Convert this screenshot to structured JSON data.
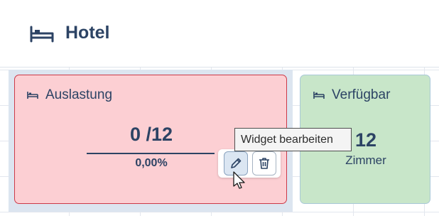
{
  "header": {
    "title": "Hotel",
    "icon": "bed-icon"
  },
  "widgets": [
    {
      "title": "Auslastung",
      "icon": "bed-icon",
      "value_text": "0 /12",
      "percent_text": "0,00%",
      "background": "#fccfd3",
      "border": "#cc3a48",
      "occupied": 0,
      "total": 12
    },
    {
      "title": "Verfügbar",
      "icon": "bed-icon",
      "value_text": "12",
      "unit_label": "Zimmer",
      "background": "#c8e6c9"
    }
  ],
  "toolbar": {
    "edit_icon": "pencil-icon",
    "delete_icon": "trash-icon"
  },
  "tooltip": {
    "text": "Widget bearbeiten"
  },
  "colors": {
    "text": "#2c4364",
    "selected_area": "#dce5f0"
  }
}
